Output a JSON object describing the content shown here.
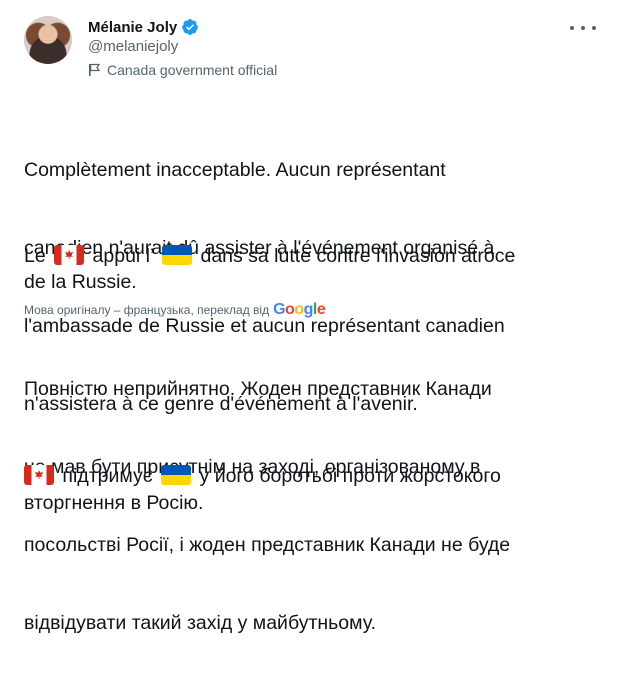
{
  "author": {
    "name": "Mélanie Joly",
    "handle": "@melaniejoly",
    "label": "Canada government official"
  },
  "tweet": {
    "original_lines": [
      "Complètement inacceptable. Aucun représentant",
      "canadien n'aurait dû assister à l'événement organisé à",
      "l'ambassade de Russie et aucun représentant canadien",
      "n'assistera à ce genre d'événement à l'avenir."
    ],
    "original_flag_line1_a": "Le",
    "original_flag_line1_b": "appui l’",
    "original_flag_line1_c": "dans sa lutte contre l'invasion atroce",
    "original_flag_line2": "de la Russie.",
    "translation_note": "Мова оригіналу – французька, переклад від",
    "translation_provider": "Google",
    "translated_lines": [
      "Повністю неприйнятно. Жоден представник Канади",
      "не мав бути присутнім на заході, організованому в",
      "посольстві Росії, і жоден представник Канади не буде",
      "відвідувати такий захід у майбутньому."
    ],
    "translated_flag_line1_b": "підтримує",
    "translated_flag_line1_c": "у його боротьбі проти жорстокого",
    "translated_flag_line2": "вторгнення в Росію."
  },
  "icons": {
    "verified": "verified-badge-icon",
    "label": "government-flag-icon",
    "more": "more-options-icon",
    "flag_canada": "canada-flag-emoji",
    "flag_ukraine": "ukraine-flag-emoji"
  },
  "colors": {
    "verified_blue": "#1d9bf0",
    "secondary_text": "#536471",
    "primary_text": "#0f1419"
  }
}
